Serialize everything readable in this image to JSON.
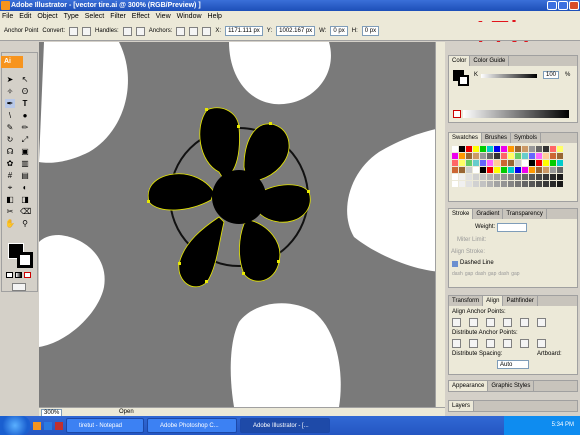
{
  "window": {
    "title": "Adobe Illustrator - [vector tire.ai @ 300% (RGB/Preview) ]"
  },
  "step_label": "17b",
  "menu": [
    "File",
    "Edit",
    "Object",
    "Type",
    "Select",
    "Filter",
    "Effect",
    "View",
    "Window",
    "Help"
  ],
  "control": {
    "mode": "Anchor Point",
    "convert_label": "Convert:",
    "handles_label": "Handles:",
    "anchors_label": "Anchors:",
    "x_label": "X:",
    "x_value": "1171.111 px",
    "y_label": "Y:",
    "y_value": "1002.167 px",
    "w_label": "W:",
    "w_value": "0 px",
    "h_label": "H:",
    "h_value": "0 px"
  },
  "toolbox": {
    "badge": "Ai"
  },
  "status": {
    "zoom": "300%",
    "state": "Open"
  },
  "color_panel": {
    "tabs": [
      "Color",
      "Color Guide"
    ],
    "k_label": "K",
    "k_value": "100",
    "k_unit": "%"
  },
  "swatches_panel": {
    "tabs": [
      "Swatches",
      "Brushes",
      "Symbols"
    ]
  },
  "stroke_panel": {
    "tabs": [
      "Stroke",
      "Gradient",
      "Transparency"
    ],
    "weight_label": "Weight:",
    "miter_label": "Miter Limit:",
    "align_label": "Align Stroke:",
    "dashed_label": "Dashed Line",
    "dash_labels": [
      "dash",
      "gap",
      "dash",
      "gap",
      "dash",
      "gap"
    ]
  },
  "align_panel": {
    "tabs": [
      "Transform",
      "Align",
      "Pathfinder"
    ],
    "align_anchor_label": "Align Anchor Points:",
    "distribute_anchor_label": "Distribute Anchor Points:",
    "distribute_spacing_label": "Distribute Spacing:",
    "artboard_label": "Artboard:",
    "spacing_value": "Auto"
  },
  "appearance_panel": {
    "tabs": [
      "Appearance",
      "Graphic Styles"
    ]
  },
  "layers_panel": {
    "tabs": [
      "Layers"
    ]
  },
  "taskbar": {
    "tasks": [
      "tiretut - Notepad",
      "Adobe Photoshop C...",
      "Adobe Illustrator - [..."
    ],
    "clock": "5:34 PM"
  },
  "colors": {
    "accent": "#f7941d",
    "step_label": "#e2141b",
    "canvas": "#7a7a7a",
    "selection": "#e8e800"
  }
}
